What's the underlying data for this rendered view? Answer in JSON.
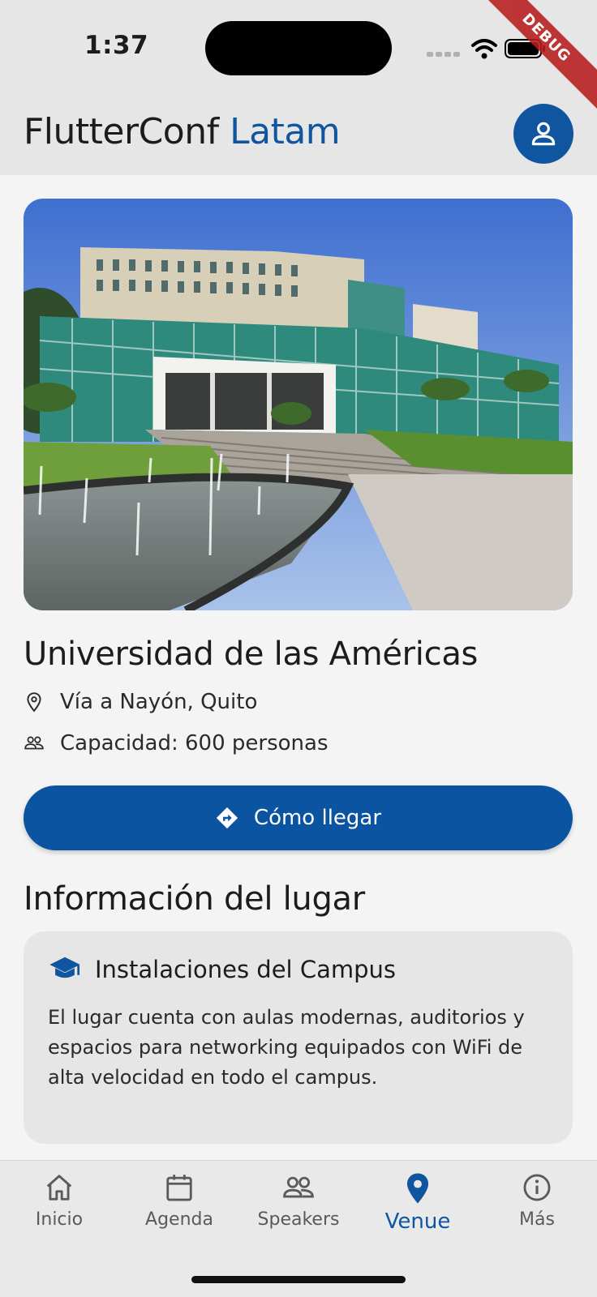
{
  "status_bar": {
    "time": "1:37",
    "debug_label": "DEBUG"
  },
  "header": {
    "title_main": "FlutterConf",
    "title_accent": "Latam",
    "accent_color": "#0f55a0"
  },
  "venue": {
    "name": "Universidad de las Américas",
    "address": "Vía a Nayón, Quito",
    "capacity": "Capacidad: 600 personas",
    "directions_label": "Cómo llegar"
  },
  "info_section": {
    "title": "Información del lugar",
    "card": {
      "title": "Instalaciones del Campus",
      "body": "El lugar cuenta con aulas modernas, auditorios y espacios para networking equipados con WiFi de alta velocidad en todo el campus."
    }
  },
  "bottom_nav": {
    "items": [
      {
        "label": "Inicio",
        "icon": "home-icon",
        "active": false
      },
      {
        "label": "Agenda",
        "icon": "calendar-icon",
        "active": false
      },
      {
        "label": "Speakers",
        "icon": "people-icon",
        "active": false
      },
      {
        "label": "Venue",
        "icon": "location-pin-icon",
        "active": true
      },
      {
        "label": "Más",
        "icon": "info-icon",
        "active": false
      }
    ]
  }
}
